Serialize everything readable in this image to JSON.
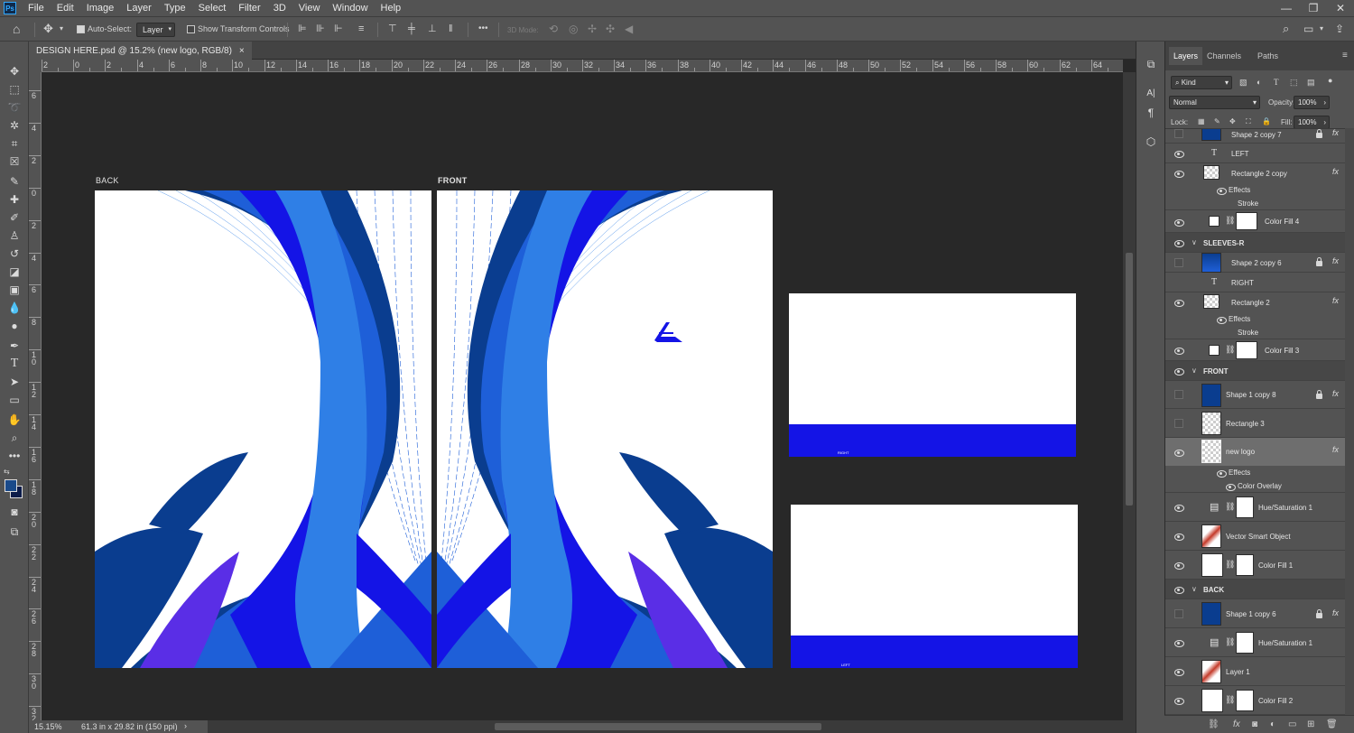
{
  "menu": {
    "app_logo": "Ps",
    "items": [
      "File",
      "Edit",
      "Image",
      "Layer",
      "Type",
      "Select",
      "Filter",
      "3D",
      "View",
      "Window",
      "Help"
    ],
    "window_controls": [
      "minimize",
      "maximize",
      "close"
    ]
  },
  "options": {
    "auto_select_label": "Auto-Select:",
    "auto_select_checked": true,
    "auto_select_target": "Layer",
    "show_transform_label": "Show Transform Controls",
    "show_transform_checked": false,
    "mode_3d_label": "3D Mode:",
    "more_label": "•••"
  },
  "document": {
    "tab_title": "DESIGN HERE.psd @ 15.2% (new logo, RGB/8)",
    "close_symbol": "×"
  },
  "rulers": {
    "h_labels": [
      "2",
      "0",
      "2",
      "4",
      "6",
      "8",
      "10",
      "12",
      "14",
      "16",
      "18",
      "20",
      "22",
      "24",
      "26",
      "28",
      "30",
      "32",
      "34",
      "36",
      "38",
      "40",
      "42",
      "44",
      "46",
      "48",
      "50",
      "52",
      "54",
      "56",
      "58",
      "60",
      "62",
      "64"
    ],
    "v_labels": [
      "6",
      "4",
      "2",
      "0",
      "2",
      "4",
      "6",
      "8",
      "1 0",
      "1 2",
      "1 4",
      "1 6",
      "1 8",
      "2 0",
      "2 2",
      "2 4",
      "2 6",
      "2 8",
      "3 0",
      "3 2"
    ]
  },
  "artboards": {
    "back_label": "BACK",
    "front_label": "FRONT",
    "right_sleeve_label": "RIGHT",
    "left_sleeve_label": "LEFT",
    "colors": {
      "blue": "#1414e6",
      "navy": "#0a3d8f",
      "royal": "#1e5fd8",
      "light": "#2f7fe6",
      "purple": "#5a2ee6"
    }
  },
  "status": {
    "zoom": "15.15%",
    "doc_info": "61.3 in x 29.82 in (150 ppi)",
    "arrow": "›"
  },
  "panel": {
    "tabs": [
      "Layers",
      "Channels",
      "Paths"
    ],
    "active_tab": "Layers",
    "kind_label": "Kind",
    "blend_mode": "Normal",
    "opacity_label": "Opacity:",
    "opacity_value": "100%",
    "lock_label": "Lock:",
    "fill_label": "Fill:",
    "fill_value": "100%",
    "layers": [
      {
        "name": "Shape 2 copy 7",
        "type": "shape",
        "visible": false,
        "lock": true,
        "fx": true
      },
      {
        "name": "LEFT",
        "type": "text",
        "visible": true
      },
      {
        "name": "Rectangle 2 copy",
        "type": "raster",
        "visible": true,
        "fx": true
      },
      {
        "name": "Effects",
        "type": "effects"
      },
      {
        "name": "Stroke",
        "type": "effect"
      },
      {
        "name": "Color Fill 4",
        "type": "fill",
        "visible": true
      },
      {
        "name": "SLEEVES-R",
        "type": "group",
        "visible": true
      },
      {
        "name": "Shape 2 copy 6",
        "type": "shape",
        "visible": false,
        "lock": true,
        "fx": true
      },
      {
        "name": "RIGHT",
        "type": "text",
        "visible": true
      },
      {
        "name": "Rectangle 2",
        "type": "raster",
        "visible": true,
        "fx": true
      },
      {
        "name": "Effects",
        "type": "effects"
      },
      {
        "name": "Stroke",
        "type": "effect"
      },
      {
        "name": "Color Fill 3",
        "type": "fill",
        "visible": true
      },
      {
        "name": "FRONT",
        "type": "group",
        "visible": true
      },
      {
        "name": "Shape 1 copy 8",
        "type": "shape",
        "visible": false,
        "lock": true,
        "fx": true
      },
      {
        "name": "Rectangle 3",
        "type": "raster",
        "visible": false
      },
      {
        "name": "new logo",
        "type": "smart",
        "visible": true,
        "fx": true,
        "selected": true
      },
      {
        "name": "Effects",
        "type": "effects"
      },
      {
        "name": "Color Overlay",
        "type": "effect-eye"
      },
      {
        "name": "Hue/Saturation 1",
        "type": "adjust",
        "visible": true
      },
      {
        "name": "Vector Smart Object",
        "type": "image",
        "visible": true
      },
      {
        "name": "Color Fill 1",
        "type": "fillwhite",
        "visible": true
      },
      {
        "name": "BACK",
        "type": "group",
        "visible": true
      },
      {
        "name": "Shape 1 copy 6",
        "type": "shape",
        "visible": false,
        "lock": true,
        "fx": true
      },
      {
        "name": "Hue/Saturation 1",
        "type": "adjust",
        "visible": true
      },
      {
        "name": "Layer 1",
        "type": "image",
        "visible": true
      },
      {
        "name": "Color Fill 2",
        "type": "fillwhite",
        "visible": true
      }
    ],
    "footer": [
      "link",
      "fx",
      "mask",
      "adjust",
      "folder",
      "new",
      "trash"
    ]
  }
}
